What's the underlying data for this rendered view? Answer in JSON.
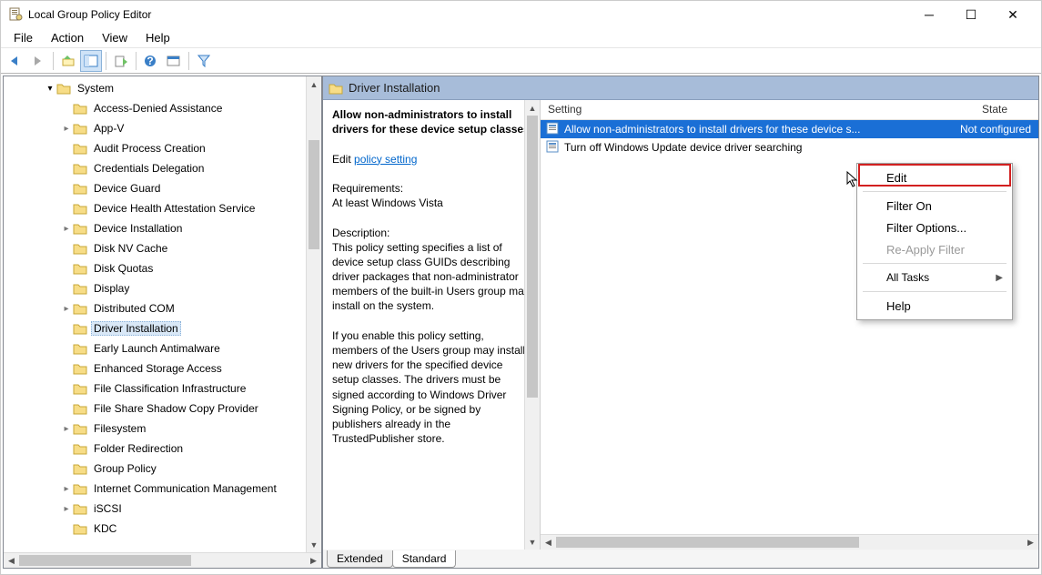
{
  "window": {
    "title": "Local Group Policy Editor"
  },
  "menus": {
    "file": "File",
    "action": "Action",
    "view": "View",
    "help": "Help"
  },
  "tree": {
    "root": "System",
    "items": [
      {
        "label": "Access-Denied Assistance",
        "exp": false,
        "chev": false
      },
      {
        "label": "App-V",
        "exp": true,
        "chev": true
      },
      {
        "label": "Audit Process Creation",
        "exp": false,
        "chev": false
      },
      {
        "label": "Credentials Delegation",
        "exp": false,
        "chev": false
      },
      {
        "label": "Device Guard",
        "exp": false,
        "chev": false
      },
      {
        "label": "Device Health Attestation Service",
        "exp": false,
        "chev": false
      },
      {
        "label": "Device Installation",
        "exp": true,
        "chev": true
      },
      {
        "label": "Disk NV Cache",
        "exp": false,
        "chev": false
      },
      {
        "label": "Disk Quotas",
        "exp": false,
        "chev": false
      },
      {
        "label": "Display",
        "exp": false,
        "chev": false
      },
      {
        "label": "Distributed COM",
        "exp": true,
        "chev": true
      },
      {
        "label": "Driver Installation",
        "exp": false,
        "chev": false,
        "selected": true
      },
      {
        "label": "Early Launch Antimalware",
        "exp": false,
        "chev": false
      },
      {
        "label": "Enhanced Storage Access",
        "exp": false,
        "chev": false
      },
      {
        "label": "File Classification Infrastructure",
        "exp": false,
        "chev": false
      },
      {
        "label": "File Share Shadow Copy Provider",
        "exp": false,
        "chev": false
      },
      {
        "label": "Filesystem",
        "exp": true,
        "chev": true
      },
      {
        "label": "Folder Redirection",
        "exp": false,
        "chev": false
      },
      {
        "label": "Group Policy",
        "exp": false,
        "chev": false
      },
      {
        "label": "Internet Communication Management",
        "exp": true,
        "chev": true
      },
      {
        "label": "iSCSI",
        "exp": true,
        "chev": true
      },
      {
        "label": "KDC",
        "exp": false,
        "chev": false
      }
    ]
  },
  "header": {
    "title": "Driver Installation"
  },
  "desc": {
    "title": "Allow non-administrators to install drivers for these device setup classes",
    "editprefix": "Edit ",
    "editlink": "policy setting",
    "reqlabel": "Requirements:",
    "reqtext": "At least Windows Vista",
    "desclabel": "Description:",
    "p1": "This policy setting specifies a list of device setup class GUIDs describing driver packages that non-administrator members of the built-in Users group may install on the system.",
    "p2": "If you enable this policy setting, members of the Users group may install new drivers for the specified device setup classes. The drivers must be signed according to Windows Driver Signing Policy, or be signed by publishers already in the TrustedPublisher store."
  },
  "list": {
    "col_setting": "Setting",
    "col_state": "State",
    "rows": [
      {
        "label": "Allow non-administrators to install drivers for these device s...",
        "state": "Not configured",
        "selected": true
      },
      {
        "label": "Turn off Windows Update device driver searching",
        "state": "",
        "selected": false
      }
    ]
  },
  "tabs": {
    "extended": "Extended",
    "standard": "Standard"
  },
  "context": {
    "edit": "Edit",
    "filter_on": "Filter On",
    "filter_options": "Filter Options...",
    "reapply": "Re-Apply Filter",
    "all_tasks": "All Tasks",
    "help": "Help"
  }
}
